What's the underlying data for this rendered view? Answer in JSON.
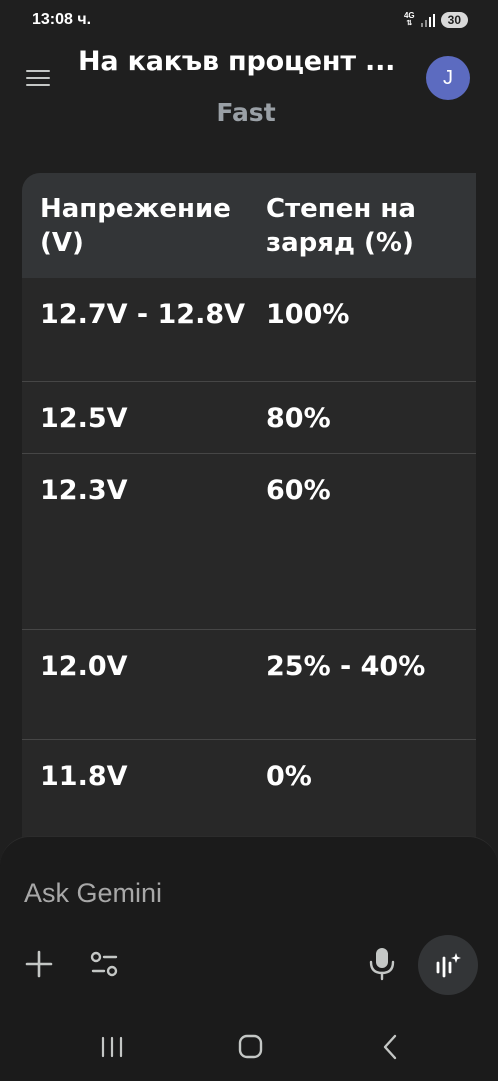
{
  "status_bar": {
    "time": "13:08 ч.",
    "network": "4G",
    "battery": "30"
  },
  "header": {
    "title": "На какъв процент ...",
    "model": "Fast",
    "avatar_letter": "J"
  },
  "table": {
    "headers": [
      "Напрежение (V)",
      "Степен на заряд (%)"
    ],
    "rows": [
      [
        "12.7V - 12.8V",
        "100%"
      ],
      [
        "12.5V",
        "80%"
      ],
      [
        "12.3V",
        "60%"
      ],
      [
        "12.0V",
        "25% - 40%"
      ],
      [
        "11.8V",
        "0%"
      ]
    ]
  },
  "input": {
    "placeholder": "Ask Gemini"
  },
  "icons": {
    "menu": "hamburger-menu-icon",
    "plus": "plus-icon",
    "tools": "tools-sliders-icon",
    "mic": "microphone-icon",
    "live": "gemini-live-icon",
    "nav_recents": "recents-icon",
    "nav_home": "home-icon",
    "nav_back": "back-icon"
  },
  "colors": {
    "background": "#1f1f1f",
    "table_header": "#333537",
    "table_body": "#282828",
    "avatar": "#5c6bc0"
  }
}
